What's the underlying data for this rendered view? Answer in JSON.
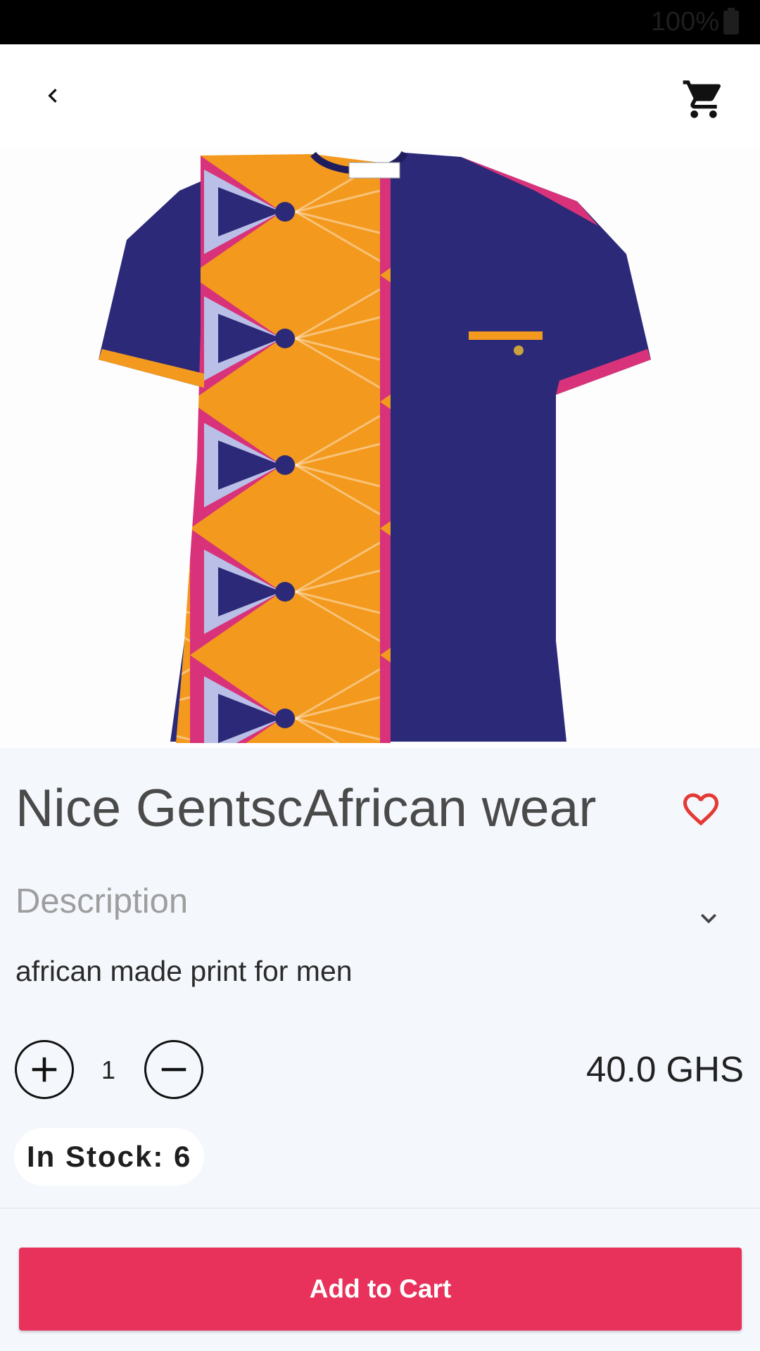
{
  "status_bar": {
    "battery": "100%"
  },
  "app_bar": {
    "back_icon": "chevron-left-icon",
    "cart_icon": "shopping-cart-icon"
  },
  "product": {
    "title": "Nice GentscAfrican wear",
    "favorite_icon": "heart-outline-icon",
    "description_heading": "Description",
    "description": "african made print for men",
    "quantity": "1",
    "price": "40.0 GHS",
    "stock_label": "In Stock: 6"
  },
  "actions": {
    "add_to_cart_label": "Add to Cart"
  },
  "colors": {
    "accent": "#e8325c",
    "background": "#f4f7fc",
    "heart": "#e53935",
    "shirt_navy": "#2c2a78",
    "print_orange": "#f39a1e",
    "print_pink": "#d8337a"
  }
}
